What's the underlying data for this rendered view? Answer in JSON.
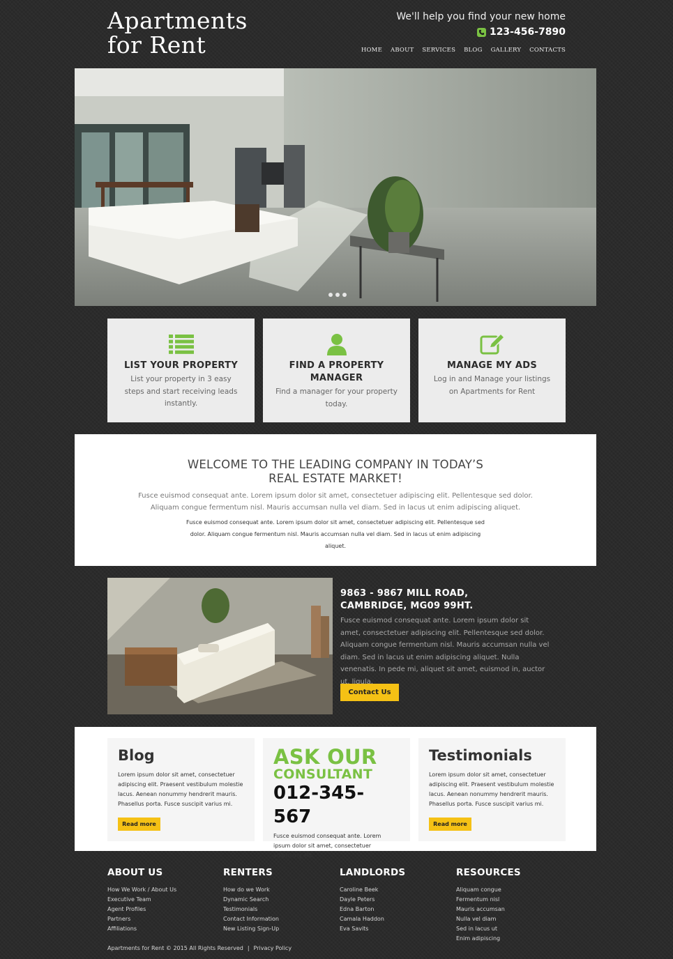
{
  "header": {
    "logo": "Apartments\nfor Rent",
    "tagline": "We'll help you find your new home",
    "phone": "123-456-7890"
  },
  "nav": [
    "HOME",
    "ABOUT",
    "SERVICES",
    "BLOG",
    "GALLERY",
    "CONTACTS"
  ],
  "features": [
    {
      "icon": "list-icon",
      "title": "LIST YOUR PROPERTY",
      "text": "List your property in 3 easy steps and start receiving leads instantly."
    },
    {
      "icon": "user-icon",
      "title": "FIND A PROPERTY MANAGER",
      "text": "Find a manager for your property today."
    },
    {
      "icon": "edit-icon",
      "title": "MANAGE MY ADS",
      "text": "Log in and Manage your listings on Apartments for Rent"
    }
  ],
  "welcome": {
    "title": "WELCOME TO THE LEADING COMPANY IN TODAY’S\nREAL ESTATE MARKET!",
    "p1": "Fusce euismod consequat ante. Lorem ipsum dolor sit amet, consectetuer adipiscing elit. Pellentesque sed dolor. Aliquam congue fermentum nisl. Mauris accumsan nulla vel diam. Sed in lacus ut enim adipiscing aliquet.",
    "p2": "Fusce euismod consequat ante. Lorem ipsum dolor sit amet, consectetuer adipiscing elit. Pellentesque sed dolor. Aliquam congue fermentum nisl. Mauris accumsan nulla vel diam. Sed in lacus ut enim adipiscing aliquet."
  },
  "address": {
    "title": "9863 - 9867 MILL ROAD,\nCAMBRIDGE, MG09 99HT.",
    "text": "Fusce euismod consequat ante. Lorem ipsum dolor sit amet, consectetuer adipiscing elit. Pellentesque sed dolor. Aliquam congue fermentum nisl. Mauris accumsan nulla vel diam. Sed in lacus ut enim adipiscing aliquet. Nulla venenatis. In pede mi, aliquet sit amet, euismod in, auctor ut, ligula.",
    "button": "Contact Us"
  },
  "panels": {
    "blog": {
      "title": "Blog",
      "text": "Lorem ipsum dolor sit amet, consectetuer adipiscing elit. Praesent vestibulum molestie lacus. Aenean nonummy hendrerit mauris. Phasellus porta. Fusce suscipit varius mi.",
      "button": "Read more"
    },
    "consultant": {
      "line1": "ASK OUR",
      "line2": "CONSULTANT",
      "phone": "012-345-567",
      "text": "Fusce euismod consequat ante. Lorem ipsum dolor sit amet, consectetuer adipiscing elit."
    },
    "testimonials": {
      "title": "Testimonials",
      "text": "Lorem ipsum dolor sit amet, consectetuer adipiscing elit. Praesent vestibulum molestie lacus. Aenean nonummy hendrerit mauris. Phasellus porta. Fusce suscipit varius mi.",
      "button": "Read more"
    }
  },
  "footer": {
    "columns": [
      {
        "title": "ABOUT US",
        "links": [
          "How We Work / About Us",
          "Executive Team",
          "Agent Profiles",
          "Partners",
          "Affiliations"
        ]
      },
      {
        "title": "RENTERS",
        "links": [
          "How do we Work",
          "Dynamic Search",
          "Testimonials",
          "Contact Information",
          "New Listing Sign-Up"
        ]
      },
      {
        "title": "LANDLORDS",
        "links": [
          "Caroline Beek",
          "Dayle Peters",
          "Edna Barton",
          "Camala Haddon",
          "Eva Savits"
        ]
      },
      {
        "title": "RESOURCES",
        "links": [
          "Aliquam congue",
          "Fermentum nisl",
          "Mauris accumsan",
          "Nulla vel diam",
          "Sed in lacus ut",
          "Enim adipiscing"
        ]
      }
    ],
    "copyright": "Apartments for Rent © 2015 All Rights Reserved",
    "separator": "|",
    "privacy": "Privacy Policy"
  },
  "colors": {
    "accent_green": "#7ac143",
    "button_yellow": "#f5c115",
    "background": "#2b2b2b"
  }
}
